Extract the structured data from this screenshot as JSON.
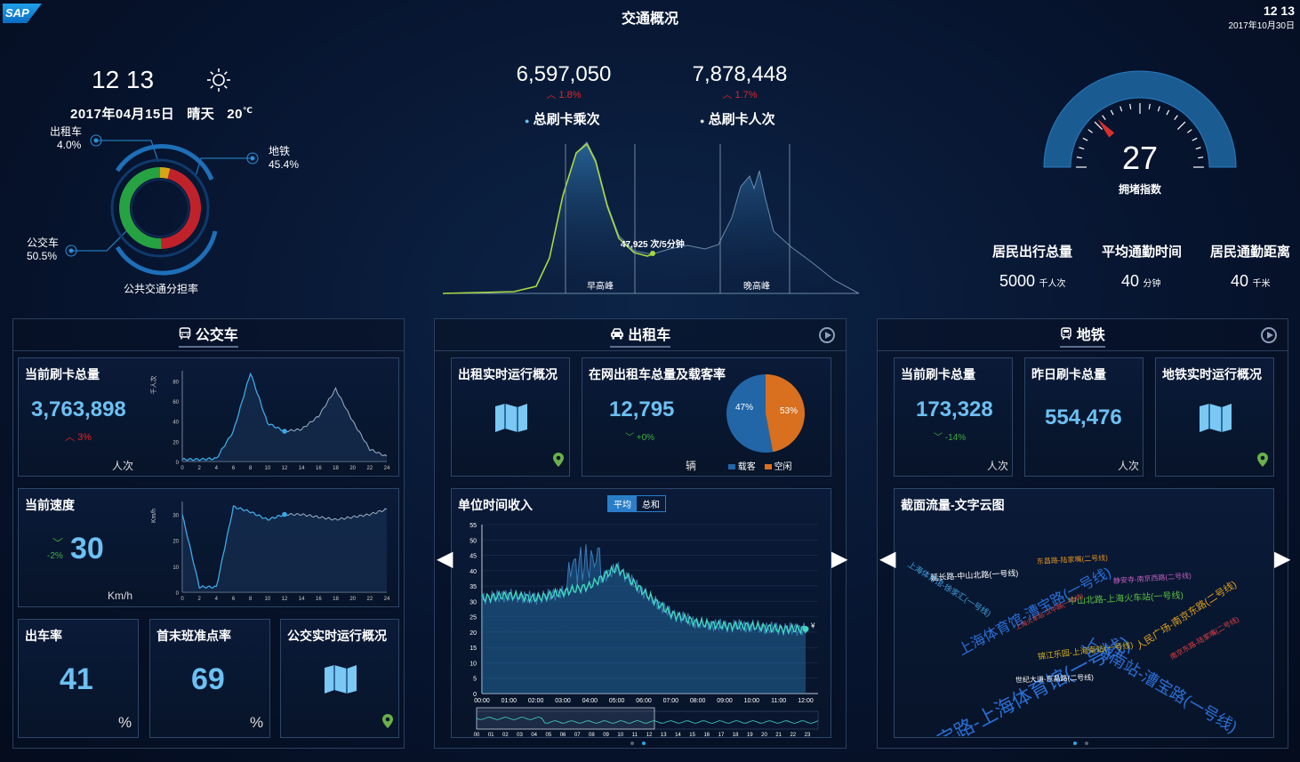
{
  "header": {
    "logo": "SAP",
    "title": "交通概况",
    "clock_time": "12 13",
    "clock_date": "2017年10月30日"
  },
  "weather": {
    "time": "12 13",
    "date": "2017年04月15日",
    "condition": "晴天",
    "temp": "20",
    "temp_unit": "℃",
    "icon": "sun-icon"
  },
  "share": {
    "title": "公共交通分担率",
    "taxi_label": "出租车",
    "taxi_value": "4.0%",
    "metro_label": "地铁",
    "metro_value": "45.4%",
    "bus_label": "公交车",
    "bus_value": "50.5%",
    "colors": {
      "metro": "#c0222c",
      "bus": "#27a242",
      "taxi": "#d6a51a"
    }
  },
  "cards": {
    "total_rides_value": "6,597,050",
    "total_rides_change": "1.8%",
    "total_rides_label": "总刷卡乘次",
    "total_people_value": "7,878,448",
    "total_people_change": "1.7%",
    "total_people_label": "总刷卡人次"
  },
  "flow_chart": {
    "annotation": "47,925 次/5分钟",
    "morning_peak": "早高峰",
    "evening_peak": "晚高峰"
  },
  "gauge": {
    "value": 27,
    "label": "拥堵指数"
  },
  "resident": {
    "total_label": "居民出行总量",
    "total_value": "5000",
    "total_unit": "千人次",
    "time_label": "平均通勤时间",
    "time_value": "40",
    "time_unit": "分钟",
    "dist_label": "居民通勤距离",
    "dist_value": "40",
    "dist_unit": "千米"
  },
  "bus": {
    "title": "公交车",
    "swipe_title": "当前刷卡总量",
    "swipe_value": "3,763,898",
    "swipe_change": "3%",
    "swipe_unit": "人次",
    "swipe_axis_unit": "千人次",
    "speed_title": "当前速度",
    "speed_value": "30",
    "speed_change": "-2%",
    "speed_unit": "Km/h",
    "speed_axis_unit": "Km/h",
    "dispatch_title": "出车率",
    "dispatch_value": "41",
    "dispatch_unit": "%",
    "ontime_title": "首末班准点率",
    "ontime_value": "69",
    "ontime_unit": "%",
    "realtime_title": "公交实时运行概况"
  },
  "taxi": {
    "title": "出租车",
    "realtime_title": "出租实时运行概况",
    "total_title": "在网出租车总量及载客率",
    "total_value": "12,795",
    "total_change": "+0%",
    "total_unit": "辆",
    "loaded_label": "载客",
    "empty_label": "空闲",
    "loaded_pct": "53%",
    "empty_pct": "47%",
    "income_title": "单位时间收入",
    "toggle_avg": "平均",
    "toggle_sum": "总和",
    "currency": "¥"
  },
  "metro": {
    "title": "地铁",
    "swipe_title": "当前刷卡总量",
    "swipe_value": "173,328",
    "swipe_change": "-14%",
    "swipe_unit": "人次",
    "yday_title": "昨日刷卡总量",
    "yday_value": "554,476",
    "yday_unit": "人次",
    "realtime_title": "地铁实时运行概况",
    "cloud_title": "截面流量-文字云图"
  },
  "word_cloud": [
    {
      "text": "漕宝路-上海体育馆(一号线)",
      "color": "#2a6fd6"
    },
    {
      "text": "上海南站-漕宝路(一号线)",
      "color": "#2a6fd6"
    },
    {
      "text": "上海体育馆-漕宝路(一号线)",
      "color": "#2a6fd6"
    },
    {
      "text": "人民广场-南京东路(二号线)",
      "color": "#e0a020"
    },
    {
      "text": "中山北路-上海火车站(一号线)",
      "color": "#58c040"
    },
    {
      "text": "锦江乐园-上海南站(一号线)",
      "color": "#d8b020"
    },
    {
      "text": "上海体育馆-徐家汇(一号线)",
      "color": "#40a0e0"
    },
    {
      "text": "延长路-中山北路(一号线)",
      "color": "#ffffff"
    },
    {
      "text": "东昌路-陆家嘴(二号线)",
      "color": "#e09020"
    },
    {
      "text": "世纪大道-东昌路(二号线)",
      "color": "#ffffff"
    },
    {
      "text": "静安寺-南京西路(二号线)",
      "color": "#c060c0"
    },
    {
      "text": "南京东路-陆家嘴(二号线)",
      "color": "#e04040"
    },
    {
      "text": "上海火车站-汉中路(一号线)",
      "color": "#e04040"
    }
  ],
  "chart_data": [
    {
      "type": "line",
      "title": "当前刷卡总量",
      "ylabel": "千人次",
      "x": [
        0,
        2,
        4,
        6,
        8,
        10,
        12,
        14,
        16,
        18,
        20,
        22,
        24
      ],
      "y_ticks": [
        0,
        20,
        40,
        60,
        80
      ],
      "series": [
        {
          "values": [
            2,
            2,
            3,
            30,
            88,
            38,
            30,
            32,
            45,
            72,
            40,
            12,
            5
          ]
        }
      ]
    },
    {
      "type": "line",
      "title": "当前速度",
      "ylabel": "Km/h",
      "x": [
        0,
        2,
        4,
        6,
        8,
        10,
        12,
        14,
        16,
        18,
        20,
        22,
        24
      ],
      "y_ticks": [
        0,
        10,
        20,
        30
      ],
      "series": [
        {
          "values": [
            30,
            2,
            2,
            33,
            31,
            28,
            30,
            30,
            29,
            28,
            29,
            30,
            32
          ]
        }
      ]
    },
    {
      "type": "pie",
      "title": "在网出租车总量及载客率",
      "categories": [
        "载客",
        "空闲"
      ],
      "values": [
        53,
        47
      ]
    },
    {
      "type": "area",
      "title": "单位时间收入",
      "x": [
        "00:00",
        "01:00",
        "02:00",
        "03:00",
        "04:00",
        "05:00",
        "06:00",
        "07:00",
        "08:00",
        "09:00",
        "10:00",
        "11:00",
        "12:00"
      ],
      "ylim": [
        0,
        55
      ],
      "y_ticks": [
        0,
        5,
        10,
        15,
        20,
        25,
        30,
        35,
        40,
        45,
        50,
        55
      ],
      "series": [
        {
          "values": [
            31,
            32,
            31,
            33,
            35,
            41,
            33,
            26,
            23,
            22,
            22,
            21,
            21
          ]
        }
      ],
      "brush_ticks": [
        "00",
        "01",
        "02",
        "03",
        "04",
        "05",
        "06",
        "07",
        "08",
        "09",
        "10",
        "11",
        "12",
        "13",
        "14",
        "15",
        "16",
        "17",
        "18",
        "19",
        "20",
        "21",
        "22",
        "23"
      ]
    }
  ]
}
